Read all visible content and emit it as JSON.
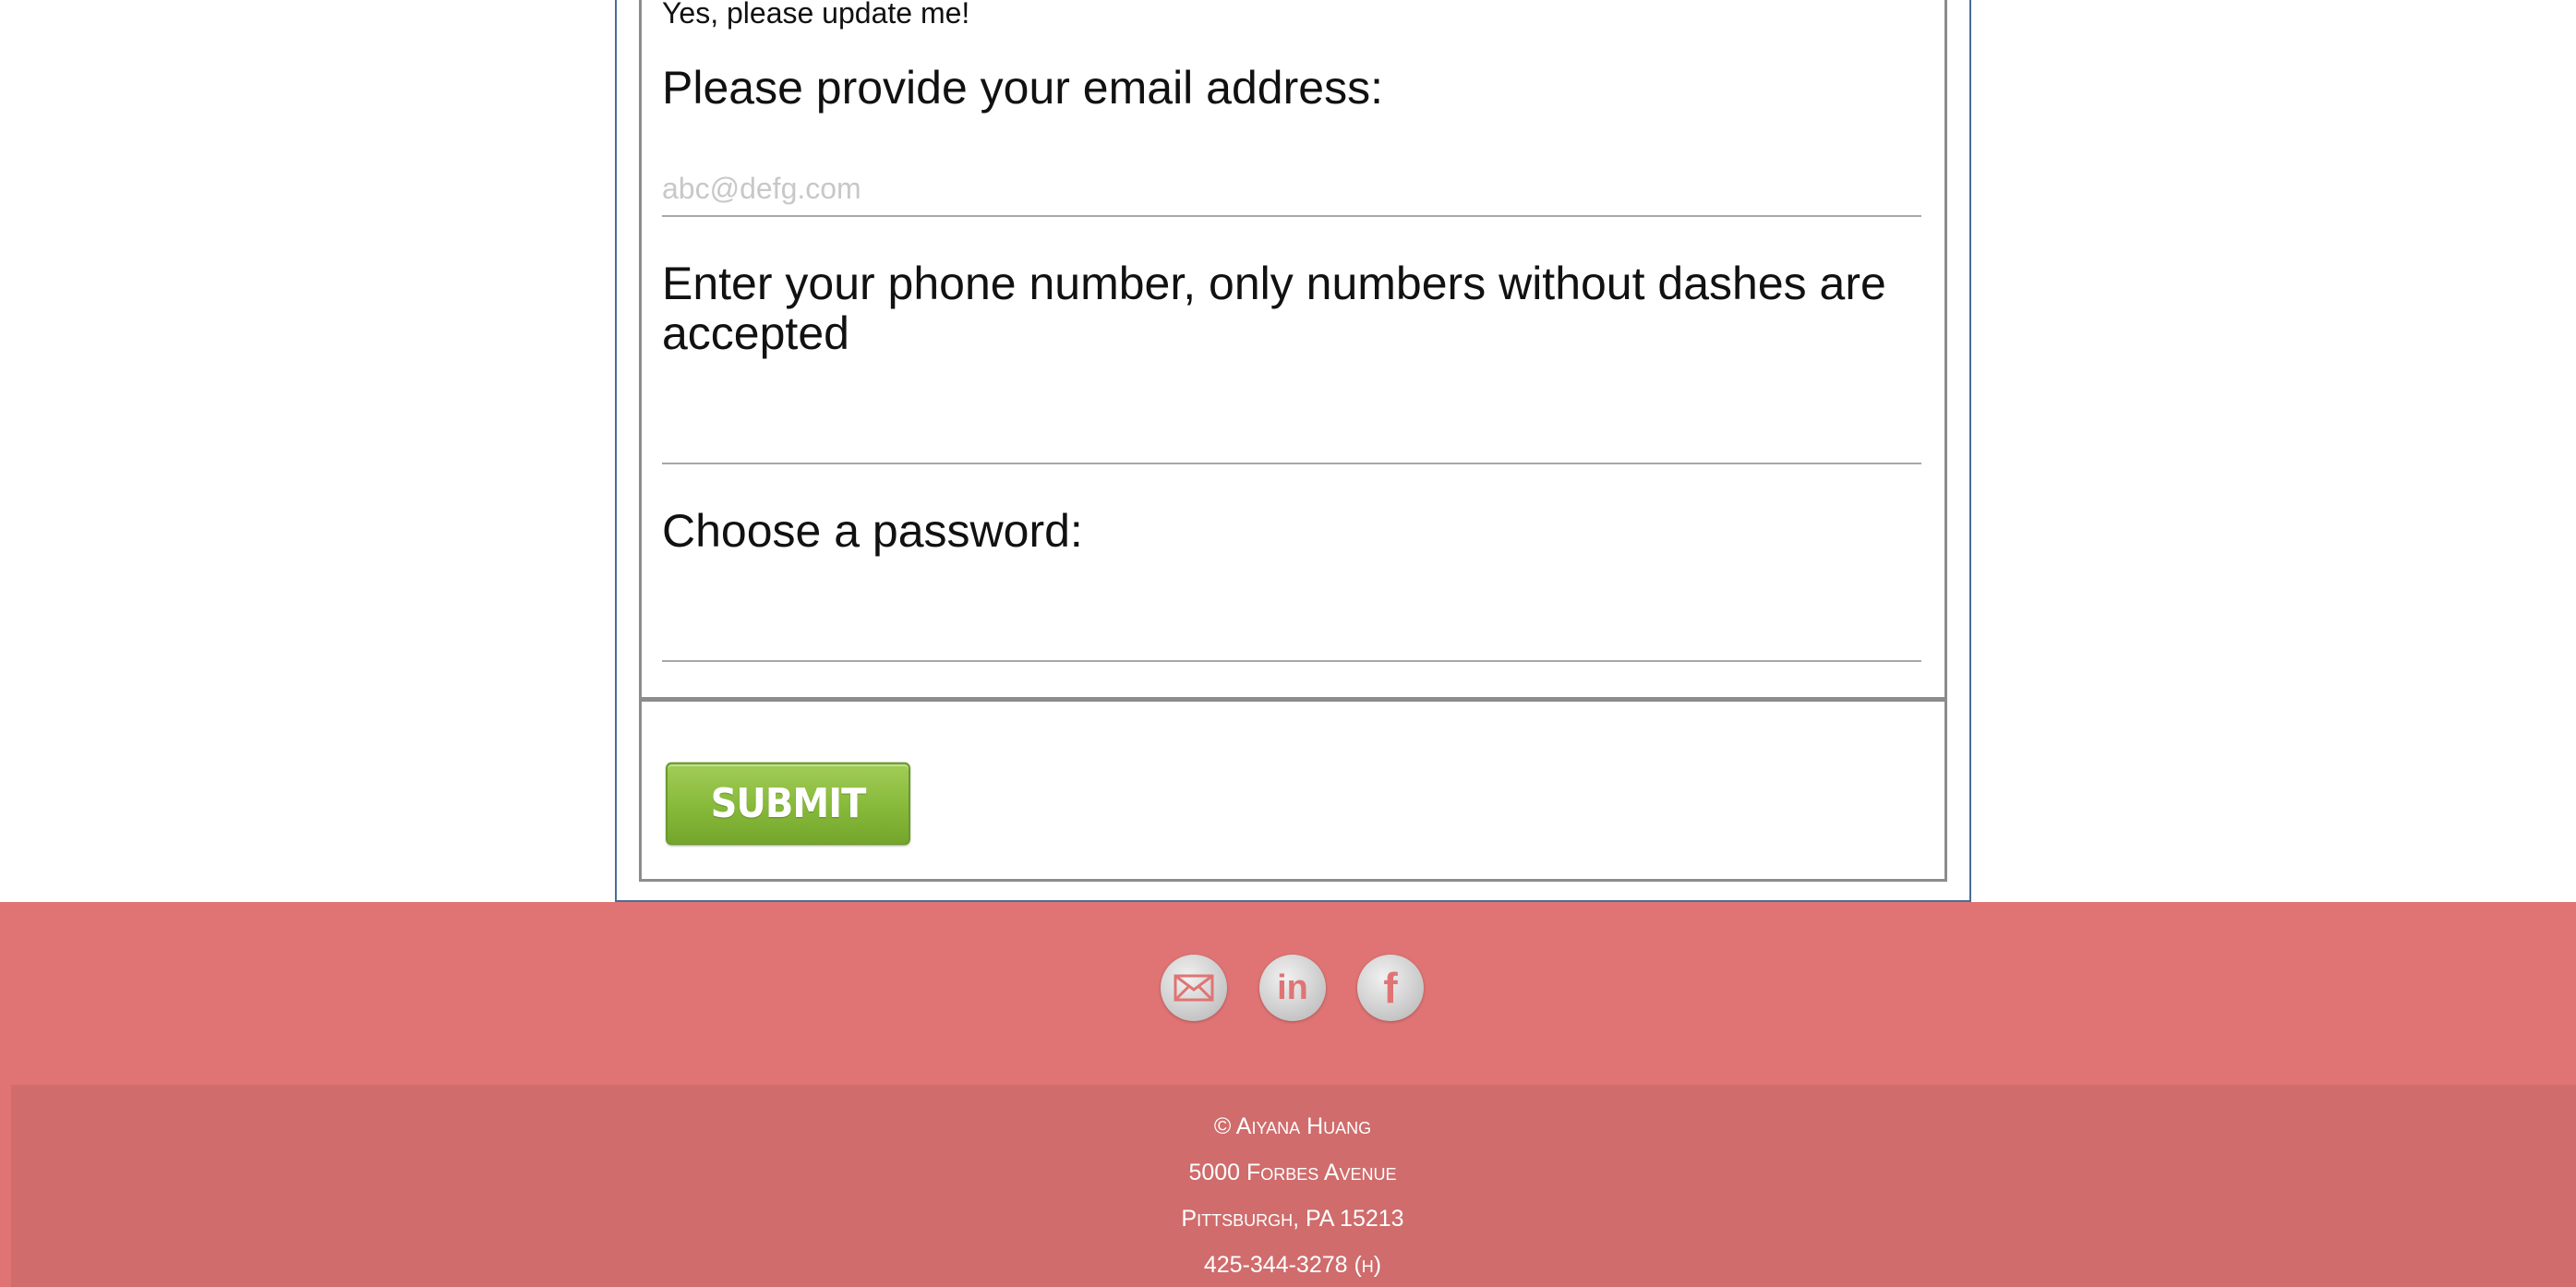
{
  "form": {
    "update_label": "Yes, please update me!",
    "email_label": "Please provide your email address:",
    "email_placeholder": "abc@defg.com",
    "email_value": "",
    "phone_label": "Enter your phone number, only numbers without dashes are accepted",
    "phone_value": "",
    "password_label": "Choose a password:",
    "password_value": "",
    "submit_label": "SUBMIT"
  },
  "footer": {
    "social_icons": [
      "mail-icon",
      "linkedin-icon",
      "facebook-icon"
    ],
    "social_glyphs": {
      "linkedin": "in",
      "facebook": "f"
    },
    "copyright": "© Aiyana Huang",
    "address_line1": "5000 Forbes Avenue",
    "address_line2": "Pittsburgh, PA 15213",
    "phone": "425-344-3278 (h)"
  },
  "colors": {
    "footer_bg": "#e07474",
    "footer_inner_bg": "#d06c6c",
    "submit_green": "#86b93a",
    "frame_border": "#4a6d93"
  }
}
